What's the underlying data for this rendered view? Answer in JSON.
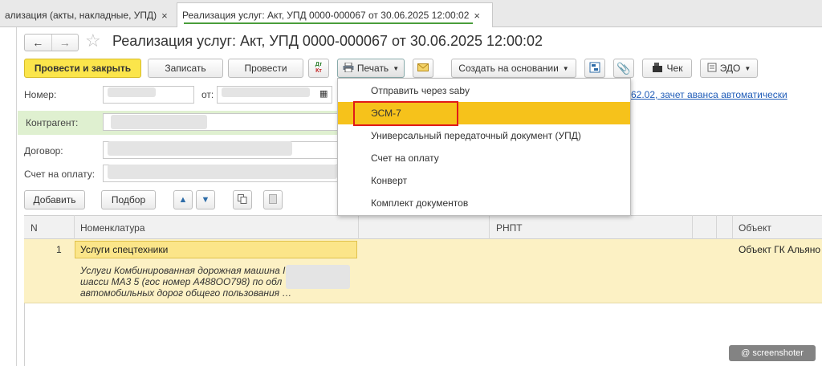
{
  "tabs": [
    {
      "label": "ализация (акты, накладные, УПД)",
      "close": "×"
    },
    {
      "label": "Реализация услуг: Акт, УПД 0000-000067 от 30.06.2025 12:00:02",
      "close": "×"
    }
  ],
  "header": {
    "back_glyph": "←",
    "forward_glyph": "→",
    "title": "Реализация услуг: Акт, УПД 0000-000067 от 30.06.2025 12:00:02"
  },
  "toolbar": {
    "post_close": "Провести и закрыть",
    "save": "Записать",
    "post": "Провести",
    "dtkt_top": "Дт",
    "dtkt_bottom": "Кт",
    "print": "Печать",
    "create_based": "Создать на основании",
    "check": "Чек",
    "edo": "ЭДО"
  },
  "form": {
    "number_label": "Номер:",
    "date_label": "от:",
    "kontragent_label": "Контрагент:",
    "dogovor_label": "Договор:",
    "invoice_label": "Счет на оплату:",
    "link_text": "62.02, зачет аванса автоматически"
  },
  "table_toolbar": {
    "add": "Добавить",
    "pick": "Подбор"
  },
  "table": {
    "columns": [
      "N",
      "Номенклатура",
      "РНПТ",
      "Объект"
    ],
    "rows": [
      {
        "n": "1",
        "item": "Услуги спецтехники",
        "description_lines": [
          "Услуги Комбинированная дорожная машина I",
          "шасси МА3 5 (гос номер А488ОО798) по обл",
          "автомобильных дорог общего пользования …"
        ],
        "object": "Объект ГК Альяно"
      }
    ]
  },
  "print_menu": {
    "items": [
      "Отправить через saby",
      "ЭСМ-7",
      "Универсальный передаточный документ (УПД)",
      "Счет на оплату",
      "Конверт",
      "Комплект документов"
    ],
    "active_index": 1
  },
  "watermark": "@ screenshoter",
  "colors": {
    "primary_button": "#fbe54b",
    "menu_highlight": "#f6c21b",
    "kontragent_row": "#dff0d0",
    "selected_row": "#fcf1c4",
    "annotation_border": "#e01a1a",
    "link": "#1f5cb8"
  }
}
